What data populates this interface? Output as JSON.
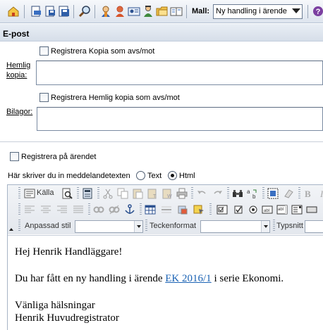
{
  "toolbar": {
    "buttons": [
      {
        "name": "home-icon"
      },
      {
        "name": "new-document-icon"
      },
      {
        "name": "save-document-icon"
      },
      {
        "name": "save-as-icon"
      },
      {
        "name": "search-icon"
      },
      {
        "name": "user-icon"
      },
      {
        "name": "user-female-icon"
      },
      {
        "name": "contact-card-icon"
      },
      {
        "name": "handler-icon"
      },
      {
        "name": "folder-icon"
      },
      {
        "name": "book-icon"
      },
      {
        "name": "help-icon"
      }
    ],
    "mall_label": "Mall:",
    "mall_value": "Ny handling i ärende"
  },
  "section": {
    "title": "E-post",
    "registrera_kopia": "Registrera Kopia som avs/mot",
    "hemlig_kopia_label_1": "Hemlig",
    "hemlig_kopia_label_2": "kopia:",
    "hemlig_kopia_value": "",
    "registrera_hemlig_kopia": "Registrera Hemlig kopia som avs/mot",
    "bilagor_label": "Bilagor:",
    "bilagor_value": "",
    "registrera_arendet": "Registrera på ärendet",
    "meddelande_label": "Här skriver du in meddelandetexten",
    "format_text": "Text",
    "format_html": "Html",
    "format_selected": "Html"
  },
  "editor": {
    "kalla_label": "Källa",
    "anpassad_stil_label": "Anpassad stil",
    "anpassad_stil_value": "",
    "teckenformat_label": "Teckenformat",
    "teckenformat_value": "",
    "typsnitt_label": "Typsnitt",
    "typsnitt_value": "",
    "line_1": "Hej Henrik Handläggare!",
    "line_2_prefix": "Du har fått en ny handling i ärende ",
    "line_2_link": "EK 2016/1",
    "line_2_suffix": " i serie Ekonomi.",
    "line_3": "Vänliga hälsningar",
    "line_4": "Henrik Huvudregistrator"
  },
  "colors": {
    "accent": "#1a62b4",
    "toolbar_bg": "#dde4ee",
    "header_bg": "#d6dee9"
  }
}
